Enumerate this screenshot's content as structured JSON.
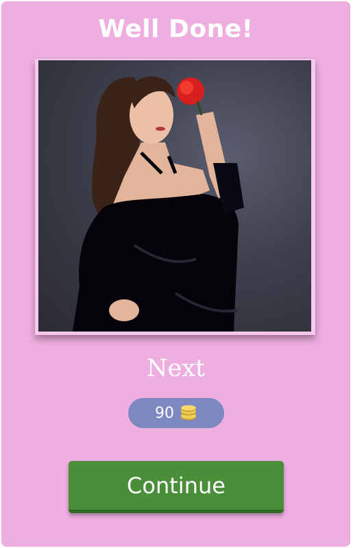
{
  "header": {
    "title": "Well Done!"
  },
  "next_label": "Next",
  "coins": {
    "value": "90",
    "icon": "coin-stack-icon"
  },
  "continue_label": "Continue",
  "colors": {
    "background": "#eeaee0",
    "coin_pill": "#7d88c1",
    "continue_button": "#4a8e3a"
  }
}
